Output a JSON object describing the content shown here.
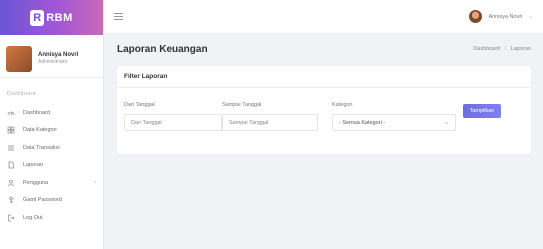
{
  "brand": {
    "logo_text": "RBM"
  },
  "profile": {
    "name": "Annisya Novri",
    "role": "Administrator"
  },
  "sidebar": {
    "section_label": "Dashboard",
    "items": [
      {
        "label": "Dashboard",
        "icon": "gauge-icon"
      },
      {
        "label": "Data Kategori",
        "icon": "grid-icon"
      },
      {
        "label": "Data Transaksi",
        "icon": "list-icon"
      },
      {
        "label": "Laporan",
        "icon": "file-icon"
      },
      {
        "label": "Pengguna",
        "icon": "user-icon",
        "has_submenu": true
      },
      {
        "label": "Ganti Password",
        "icon": "key-icon"
      },
      {
        "label": "Log Out",
        "icon": "logout-icon"
      }
    ]
  },
  "topbar": {
    "user_name": "Annisya Novri"
  },
  "page": {
    "title": "Laporan Keuangan",
    "breadcrumb": [
      "Dashboard",
      "Laporan"
    ]
  },
  "filter": {
    "card_title": "Filter Laporan",
    "from_label": "Dari Tanggal",
    "from_placeholder": "Dari Tanggal",
    "to_label": "Sampai Tanggal",
    "to_placeholder": "Sampai Tanggal",
    "category_label": "Kategori",
    "category_value": "- Semua Kategori -",
    "button_label": "Tampilkan"
  },
  "colors": {
    "accent": "#7173e6",
    "brand_start": "#6a55d6",
    "brand_end": "#c86ab6"
  }
}
